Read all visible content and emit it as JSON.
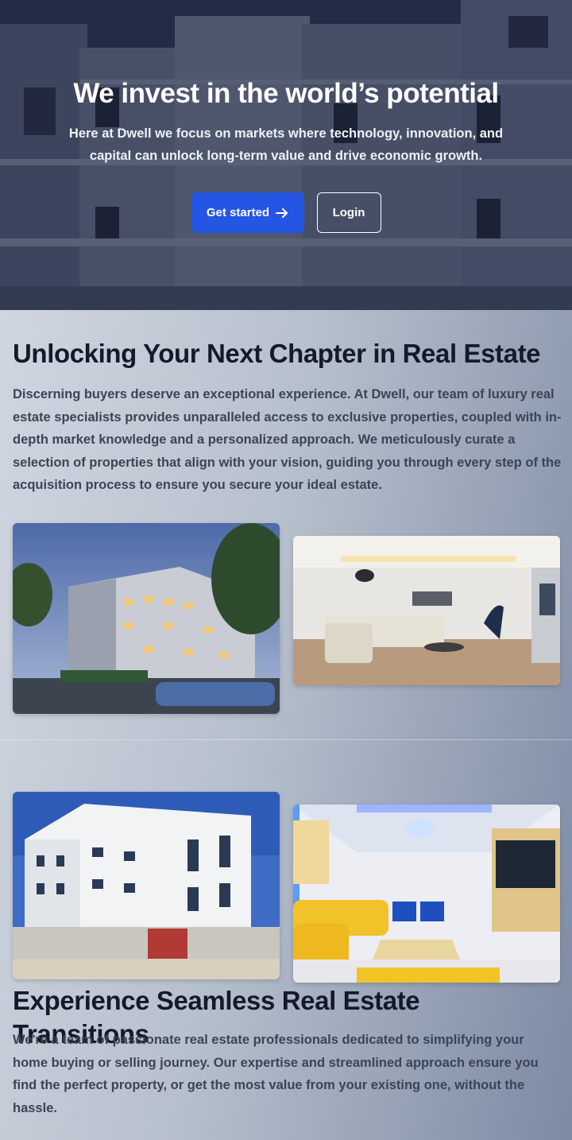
{
  "hero": {
    "title": "We invest in the world’s potential",
    "subtitle": "Here at Dwell we focus on markets where technology, innovation, and capital can unlock long-term value and drive economic growth.",
    "primary_button": "Get started",
    "secondary_button": "Login"
  },
  "section1": {
    "heading": "Unlocking Your Next Chapter in Real Estate",
    "body": "Discerning buyers deserve an exceptional experience. At Dwell, our team of luxury real estate specialists provides unparalleled access to exclusive properties, coupled with in-depth market knowledge and a personalized approach. We meticulously curate a selection of properties that align with your vision, guiding you through every step of the acquisition process to ensure you secure your ideal estate."
  },
  "section2": {
    "heading": "Experience Seamless Real Estate Transitions",
    "body": "We're a team of passionate real estate professionals dedicated to simplifying your home buying or selling journey. Our expertise and streamlined approach ensure you find the perfect property, or get the most value from your existing one, without the hassle."
  },
  "colors": {
    "accent": "#2456e3",
    "heading": "#141a2b",
    "body_text": "#3c4456"
  }
}
